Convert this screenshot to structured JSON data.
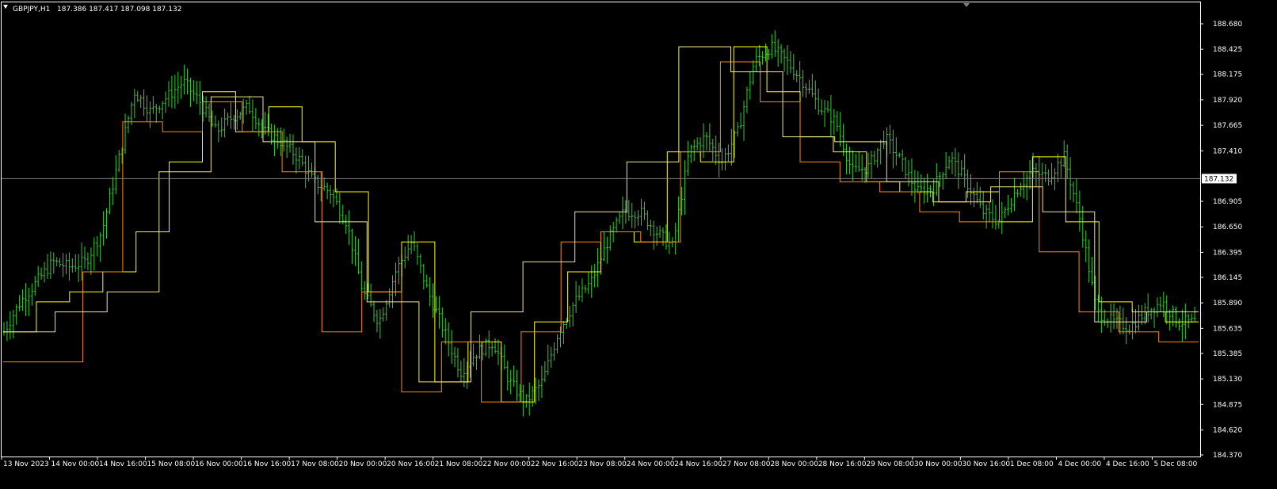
{
  "window": {
    "symbol_label": "GBPJPY,H1",
    "ohlc_label": "187.386 187.417 187.098 187.132"
  },
  "colors": {
    "background": "#000000",
    "frame": "#ffffff",
    "candles": "#32cd32",
    "bid_line": "#808080",
    "yellow_line": "#ffff00",
    "orange_line": "#ff8c00",
    "khaki_line": "#f0e68c"
  },
  "chart_data": {
    "type": "line",
    "title": "GBPJPY,H1",
    "subtitle": "187.386 187.417 187.098 187.132",
    "current_price": 187.132,
    "current_price_label": "187.132",
    "ylim": [
      184.37,
      188.68
    ],
    "y_ticks": [
      "188.680",
      "188.425",
      "188.175",
      "187.920",
      "187.665",
      "187.410",
      "186.905",
      "186.650",
      "186.395",
      "186.145",
      "185.890",
      "185.635",
      "185.385",
      "185.130",
      "184.875",
      "184.620",
      "184.370"
    ],
    "x_ticks": [
      "13 Nov 2023",
      "14 Nov 00:00",
      "14 Nov 16:00",
      "15 Nov 08:00",
      "16 Nov 00:00",
      "16 Nov 16:00",
      "17 Nov 08:00",
      "20 Nov 00:00",
      "20 Nov 16:00",
      "21 Nov 08:00",
      "22 Nov 00:00",
      "22 Nov 16:00",
      "23 Nov 08:00",
      "24 Nov 00:00",
      "24 Nov 16:00",
      "27 Nov 08:00",
      "28 Nov 00:00",
      "28 Nov 16:00",
      "29 Nov 08:00",
      "30 Nov 00:00",
      "30 Nov 16:00",
      "1 Dec 08:00",
      "4 Dec 00:00",
      "4 Dec 16:00",
      "5 Dec 08:00"
    ],
    "grid": false,
    "price_path": [
      185.6,
      185.9,
      186.1,
      186.3,
      186.25,
      186.3,
      186.6,
      187.3,
      188.0,
      187.8,
      187.95,
      188.1,
      187.9,
      187.6,
      187.75,
      187.85,
      187.6,
      187.5,
      187.35,
      187.1,
      187.0,
      186.7,
      186.0,
      185.7,
      186.2,
      186.5,
      186.0,
      185.6,
      185.2,
      185.4,
      185.5,
      185.1,
      184.9,
      185.1,
      185.6,
      185.9,
      186.1,
      186.5,
      186.8,
      186.8,
      186.6,
      186.45,
      187.4,
      187.55,
      187.3,
      187.6,
      188.3,
      188.45,
      188.3,
      188.1,
      187.85,
      187.7,
      187.2,
      187.25,
      187.55,
      187.3,
      187.0,
      187.05,
      187.35,
      187.1,
      186.8,
      186.7,
      187.0,
      187.2,
      187.15,
      187.35,
      186.7,
      185.8,
      185.7,
      185.65,
      185.8,
      185.9,
      185.7,
      185.7
    ],
    "price_path_candles": 384,
    "series": [
      {
        "color": "#ffff00",
        "values": [
          185.6,
          185.9,
          186.0,
          186.2,
          186.6,
          187.3,
          188.0,
          187.6,
          187.85,
          187.5,
          187.0,
          186.0,
          186.5,
          185.1,
          185.5,
          184.9,
          185.7,
          186.2,
          186.6,
          186.5,
          187.4,
          187.3,
          188.45,
          188.0,
          187.55,
          187.4,
          187.1,
          187.0,
          186.9,
          187.0,
          186.7,
          187.35,
          186.7,
          185.9,
          185.8,
          185.7
        ]
      },
      {
        "color": "#ff8c00",
        "values": [
          185.3,
          185.3,
          186.2,
          187.7,
          187.6,
          187.9,
          187.6,
          187.2,
          185.6,
          186.0,
          185.0,
          185.5,
          184.9,
          185.6,
          186.5,
          186.6,
          186.5,
          187.4,
          188.3,
          187.9,
          187.3,
          187.1,
          187.0,
          186.8,
          186.7,
          187.2,
          186.4,
          185.8,
          185.6,
          185.5
        ]
      },
      {
        "color": "#f0e68c",
        "values": [
          185.6,
          185.8,
          186.0,
          187.2,
          187.95,
          187.5,
          186.7,
          185.9,
          185.1,
          185.8,
          186.3,
          186.8,
          187.3,
          188.45,
          188.2,
          187.55,
          187.5,
          187.1,
          186.9,
          187.05,
          186.8,
          185.7,
          185.8
        ]
      }
    ]
  }
}
